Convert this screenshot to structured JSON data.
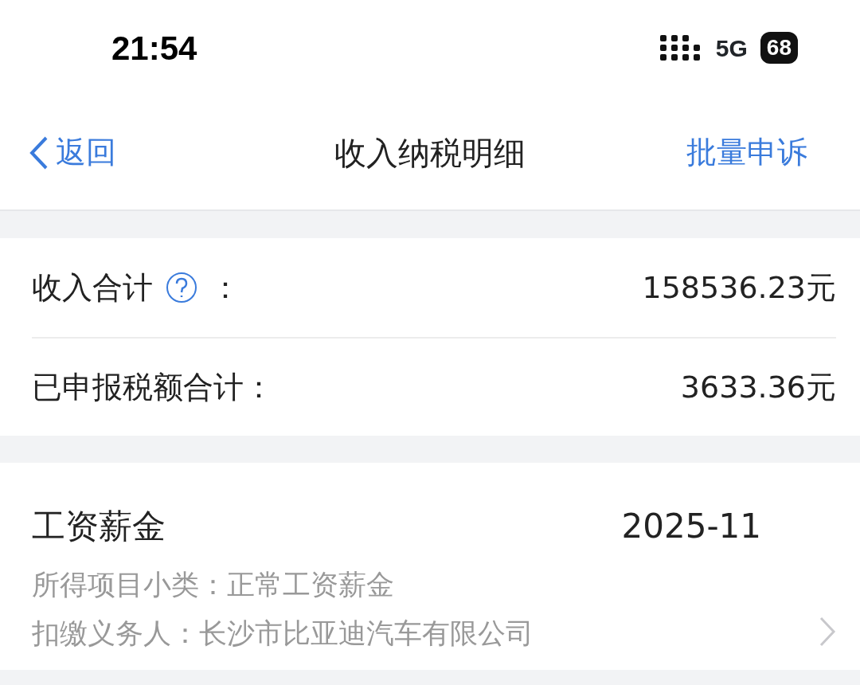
{
  "status_bar": {
    "time": "21:54",
    "network": "5G",
    "battery": "68"
  },
  "nav": {
    "back": "返回",
    "title": "收入纳税明细",
    "action": "批量申诉"
  },
  "summary": [
    {
      "label": "收入合计",
      "help": true,
      "colon": "：",
      "value": "158536.23元"
    },
    {
      "label": "已申报税额合计：",
      "help": false,
      "value": "3633.36元"
    }
  ],
  "record": {
    "type": "工资薪金",
    "period": "2025-11",
    "lines": [
      {
        "label": "所得项目小类：",
        "value": "正常工资薪金"
      },
      {
        "label": "扣缴义务人：",
        "value": "长沙市比亚迪汽车有限公司"
      }
    ]
  }
}
